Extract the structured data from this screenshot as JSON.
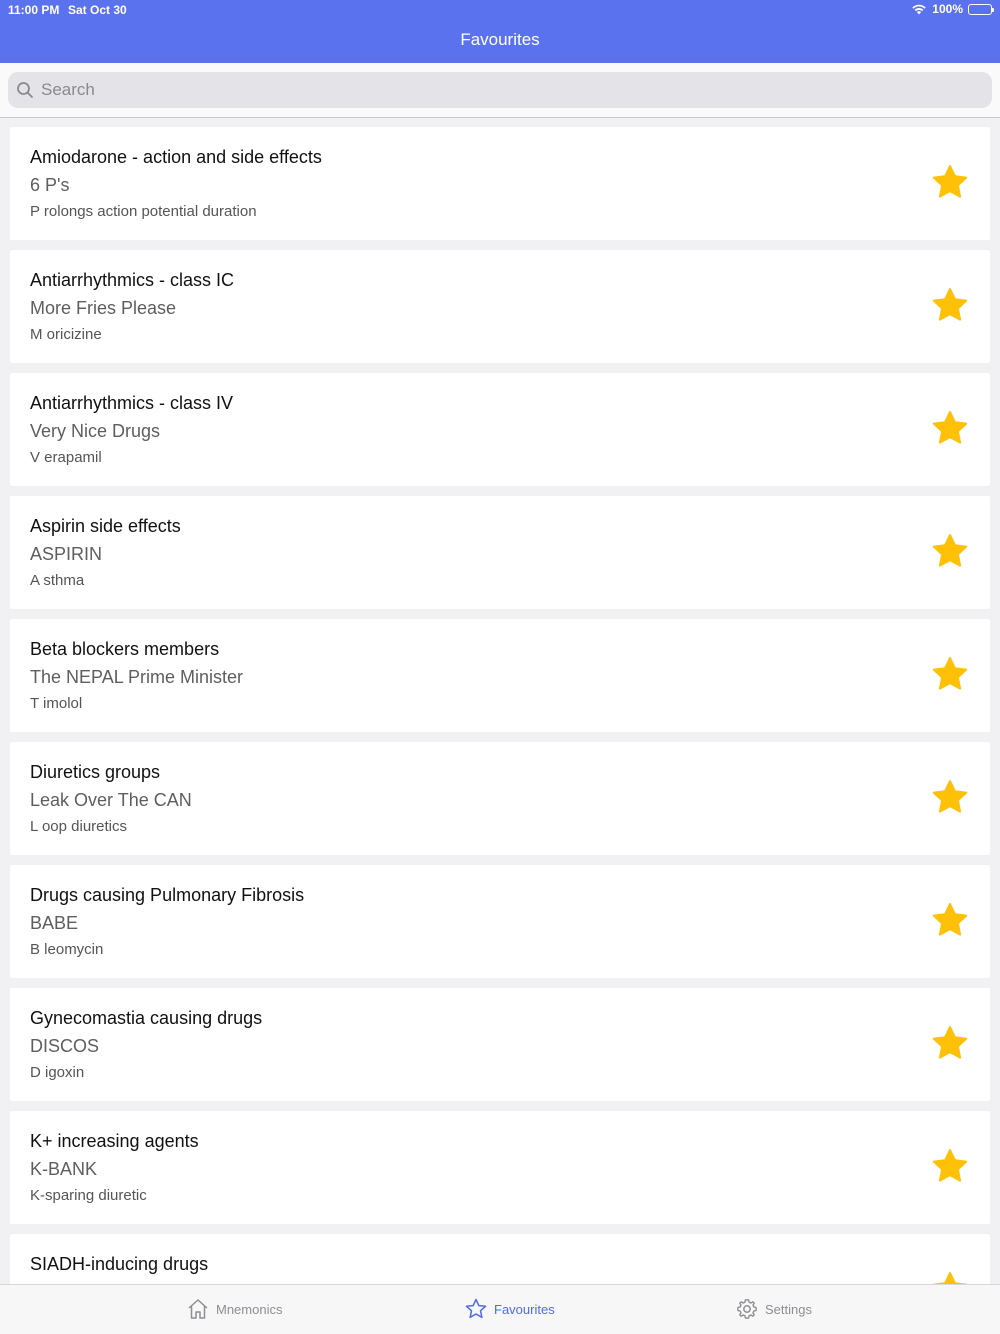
{
  "status_bar": {
    "time": "11:00 PM",
    "date": "Sat Oct 30",
    "battery": "100%"
  },
  "nav": {
    "title": "Favourites"
  },
  "search": {
    "placeholder": "Search"
  },
  "colors": {
    "accent": "#5b72ef",
    "star": "#ffc107"
  },
  "items": [
    {
      "title": "Amiodarone - action and side effects",
      "mnemonic": "6 P's",
      "detail": "P rolongs action potential duration"
    },
    {
      "title": "Antiarrhythmics - class IC",
      "mnemonic": "More Fries Please",
      "detail": "M oricizine"
    },
    {
      "title": "Antiarrhythmics - class IV",
      "mnemonic": "Very Nice Drugs",
      "detail": "V erapamil"
    },
    {
      "title": "Aspirin side effects",
      "mnemonic": "ASPIRIN",
      "detail": "A sthma"
    },
    {
      "title": "Beta blockers members",
      "mnemonic": "The NEPAL Prime Minister",
      "detail": "T imolol"
    },
    {
      "title": "Diuretics groups",
      "mnemonic": "Leak Over The CAN",
      "detail": "L oop diuretics"
    },
    {
      "title": "Drugs causing Pulmonary Fibrosis",
      "mnemonic": "BABE",
      "detail": "B leomycin"
    },
    {
      "title": "Gynecomastia causing drugs",
      "mnemonic": "DISCOS",
      "detail": "D igoxin"
    },
    {
      "title": "K+ increasing agents",
      "mnemonic": "K-BANK",
      "detail": "K-sparing diuretic"
    },
    {
      "title": "SIADH-inducing drugs",
      "mnemonic": "",
      "detail": ""
    }
  ],
  "tabs": [
    {
      "label": "Mnemonics",
      "icon": "home-icon"
    },
    {
      "label": "Favourites",
      "icon": "star-icon"
    },
    {
      "label": "Settings",
      "icon": "gear-icon"
    }
  ]
}
